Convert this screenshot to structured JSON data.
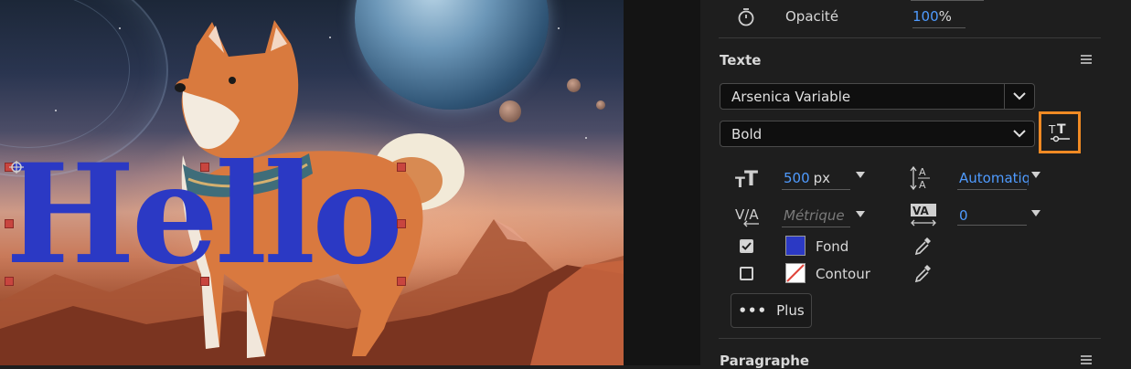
{
  "canvas": {
    "text_layer": "Hello",
    "text_color": "#2b39c4"
  },
  "panel": {
    "opacity": {
      "label": "Opacité",
      "value": "100",
      "unit": "%"
    },
    "text_section": {
      "title": "Texte",
      "font_family": "Arsenica Variable",
      "font_style": "Bold",
      "font_size": {
        "value": "500",
        "unit": "px"
      },
      "leading": "Automatiq",
      "kerning": "Métrique",
      "tracking": "0",
      "fill": {
        "label": "Fond",
        "checked": true,
        "color": "#2b39c4"
      },
      "stroke": {
        "label": "Contour",
        "checked": false
      },
      "more_label": "Plus"
    },
    "paragraph_section": {
      "title": "Paragraphe"
    }
  },
  "colors": {
    "accent_highlight": "#f08a24",
    "value_blue": "#4f9bff"
  }
}
